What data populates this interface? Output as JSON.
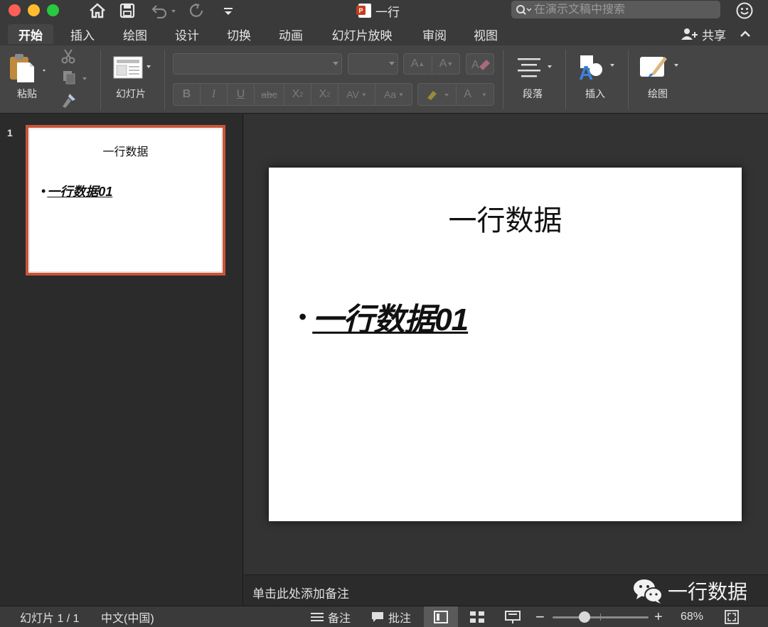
{
  "window": {
    "title": "一行",
    "search_placeholder": "在演示文稿中搜索"
  },
  "tabs": [
    {
      "label": "开始",
      "active": true
    },
    {
      "label": "插入"
    },
    {
      "label": "绘图"
    },
    {
      "label": "设计"
    },
    {
      "label": "切换"
    },
    {
      "label": "动画"
    },
    {
      "label": "幻灯片放映"
    },
    {
      "label": "审阅"
    },
    {
      "label": "视图"
    }
  ],
  "share_label": "共享",
  "ribbon": {
    "paste_label": "粘贴",
    "slide_label": "幻灯片",
    "paragraph_label": "段落",
    "insert_label": "插入",
    "draw_label": "绘图",
    "font_buttons": {
      "bold": "B",
      "italic": "I",
      "underline": "U",
      "strike": "abc",
      "superscript": "X",
      "sup_mark": "2",
      "subscript": "X",
      "sub_mark": "2",
      "spacing": "AV",
      "case": "Aa",
      "grow": "A",
      "shrink": "A",
      "font_color": "A"
    }
  },
  "slides_panel": {
    "slide_number": "1",
    "thumb_title": "一行数据",
    "thumb_bullet": "一行数据01"
  },
  "slide": {
    "title": "一行数据",
    "bullet": "一行数据01"
  },
  "notes": {
    "placeholder": "单击此处添加备注",
    "watermark": "一行数据"
  },
  "status_bar": {
    "slide_counter": "幻灯片 1 / 1",
    "language": "中文(中国)",
    "notes_label": "备注",
    "comments_label": "批注",
    "zoom_minus": "−",
    "zoom_plus": "+",
    "zoom_level": "68%",
    "zoom_fraction": 0.68
  },
  "colors": {
    "accent_selection": "#c9553a",
    "ppt_brand": "#c43e1c"
  }
}
